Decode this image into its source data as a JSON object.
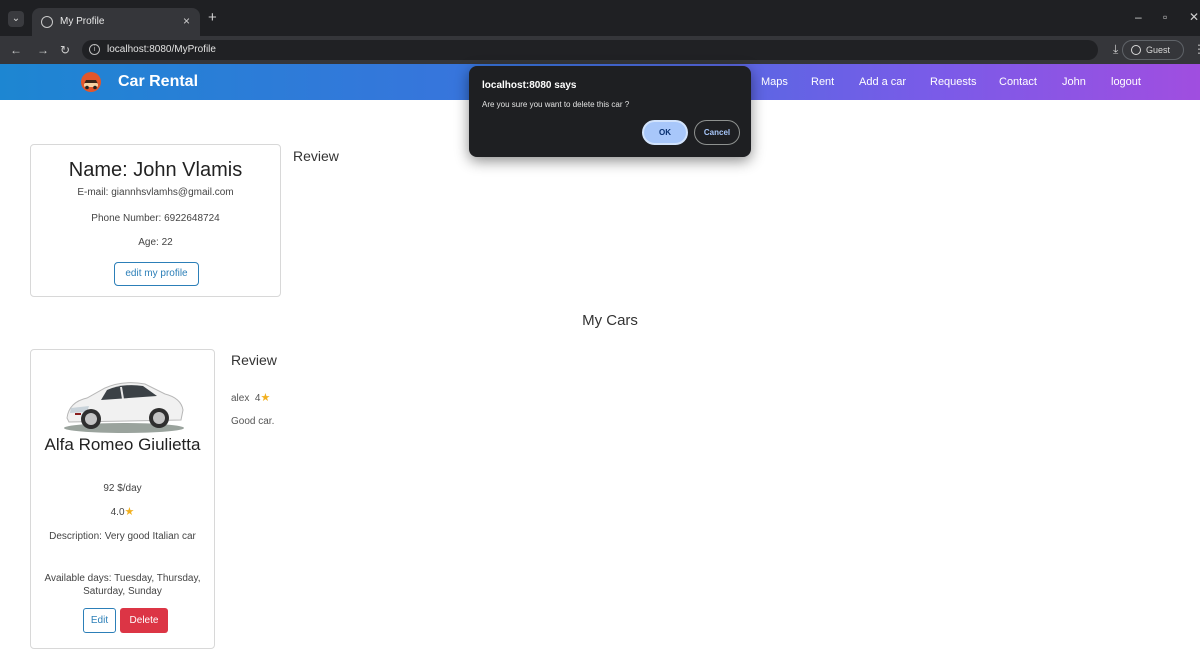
{
  "browser": {
    "tab_title": "My Profile",
    "tab_close": "×",
    "new_tab": "+",
    "url": "localhost:8080/MyProfile",
    "profile_label": "Guest",
    "controls": {
      "back": "←",
      "forward": "→",
      "reload": "↻",
      "minimize": "–",
      "restore": "▫",
      "close": "✕",
      "download": "⤓",
      "menu": "⋮",
      "tab_menu": "⌄"
    }
  },
  "navbar": {
    "brand": "Car Rental",
    "links": [
      "Maps",
      "Rent",
      "Add a car",
      "Requests",
      "Contact",
      "John",
      "logout"
    ],
    "gradient": [
      "#1d86d2",
      "#a04ee0"
    ]
  },
  "profile": {
    "name": "Name: John Vlamis",
    "email": "E-mail: giannhsvlamhs@gmail.com",
    "phone": "Phone Number: 6922648724",
    "age": "Age: 22",
    "edit_button": "edit my profile",
    "review_heading": "Review"
  },
  "my_cars": {
    "heading": "My Cars",
    "cars": [
      {
        "name": "Alfa Romeo Giulietta",
        "price": "92 $/day",
        "rating": "4.0",
        "description": "Description: Very good Italian car",
        "available_days": "Available days: Tuesday, Thursday, Saturday, Sunday",
        "edit_button": "Edit",
        "delete_button": "Delete",
        "review_heading": "Review",
        "reviews": [
          {
            "user": "alex",
            "stars": "4",
            "text": "Good car."
          }
        ]
      }
    ]
  },
  "dialog": {
    "title": "localhost:8080 says",
    "message": "Are you sure you want to delete this car ?",
    "ok": "OK",
    "cancel": "Cancel"
  },
  "colors": {
    "primary": "#2c7fb8",
    "danger": "#dc3545",
    "star": "#f2b01e"
  }
}
